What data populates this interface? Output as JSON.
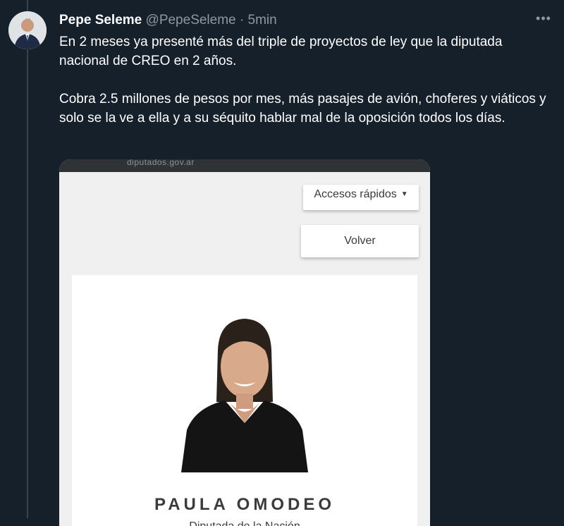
{
  "tweet": {
    "display_name": "Pepe Seleme",
    "handle": "@PepeSeleme",
    "separator": "·",
    "time": "5min",
    "more_icon": "ellipsis-icon",
    "paragraphs": [
      "En 2 meses ya presenté más del triple de proyectos de ley que la diputada nacional de CREO en 2 años.",
      "Cobra 2.5 millones de pesos por mes, más pasajes de avión, choferes y viáticos y solo se la ve a ella y a su séquito hablar mal de la oposición todos los días."
    ]
  },
  "media": {
    "url_text": "diputados.gov.ar",
    "quick_access_label": "Accesos rápidos",
    "back_label": "Volver",
    "person_name": "PAULA OMODEO",
    "person_role": "Diputada de la Nación"
  },
  "colors": {
    "background": "#15202b",
    "text_primary": "#ffffff",
    "text_secondary": "#8b98a5"
  }
}
